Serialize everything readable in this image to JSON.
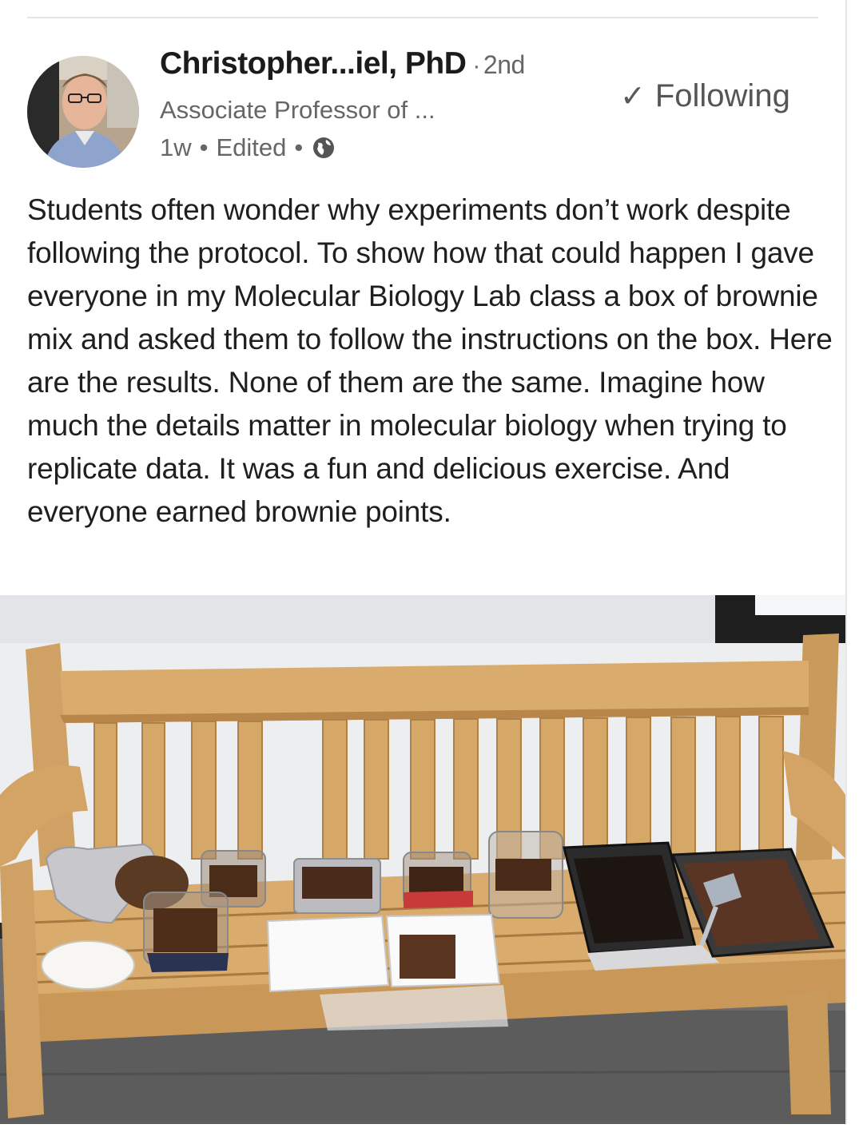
{
  "post": {
    "author_name": "Christopher...iel, PhD",
    "connection_dot": "·",
    "connection_degree": "2nd",
    "author_headline": "Associate Professor of ...",
    "time_ago": "1w",
    "edited_label": "Edited",
    "meta_dot": "•",
    "visibility_icon": "globe-icon",
    "follow_check": "✓",
    "follow_label": "Following",
    "body": "Students often wonder why experiments don’t work despite following the protocol. To show how that could happen I gave everyone in my Molecular Biology Lab class a box of brownie mix and asked them to follow the instructions on the box. Here are the results. None of them are the same. Imagine how much the details matter in molecular biology when trying to replicate data. It was a fun and delicious exercise. And everyone earned brownie points."
  },
  "colors": {
    "text_primary": "#1b1b1b",
    "text_secondary": "#666666",
    "follow_text": "#555555"
  }
}
